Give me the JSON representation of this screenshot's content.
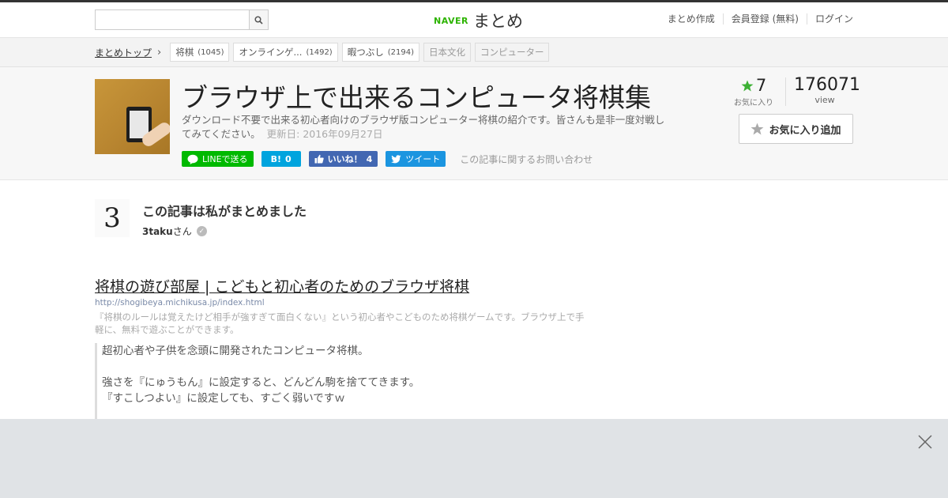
{
  "header": {
    "search": {
      "value": "",
      "placeholder": ""
    },
    "logo_naver": "NAVER",
    "logo_matome": "まとめ",
    "nav": [
      "まとめ作成",
      "会員登録 (無料)",
      "ログイン"
    ]
  },
  "breadcrumb": {
    "top": "まとめトップ",
    "tags": [
      {
        "label": "将棋",
        "count": "(1045)"
      },
      {
        "label": "オンラインゲ...",
        "count": "(1492)"
      },
      {
        "label": "暇つぶし",
        "count": "(2194)"
      },
      {
        "label": "日本文化",
        "count": ""
      },
      {
        "label": "コンピューター",
        "count": ""
      }
    ]
  },
  "article": {
    "title": "ブラウザ上で出来るコンピュータ将棋集",
    "description": "ダウンロード不要で出来る初心者向けのブラウザ版コンピューター将棋の紹介です。皆さんも是非一度対戦してみてください。",
    "updated": "更新日: 2016年09月27日",
    "share": {
      "line": "LINEで送る",
      "hatena_icon": "B!",
      "hatena_count": "0",
      "fb": "いいね！",
      "fb_count": "4",
      "tweet": "ツイート",
      "contact": "この記事に関するお問い合わせ"
    },
    "favorites_count": "7",
    "favorites_label": "お気に入り",
    "views_count": "176071",
    "views_label": "view",
    "fav_button": "お気に入り追加"
  },
  "author": {
    "avatar_text": "3",
    "heading": "この記事は私がまとめました",
    "name": "3taku",
    "suffix": "さん"
  },
  "link": {
    "title": "将棋の遊び部屋 | こどもと初心者のためのブラウザ将棋",
    "url": "http://shogibeya.michikusa.jp/index.html",
    "description": "『将棋のルールは覚えたけど相手が強すぎて面白くない』という初心者やこどものため将棋ゲームです。ブラウザ上で手軽に、無料で遊ぶことができます。",
    "quote_lines": [
      "超初心者や子供を念頭に開発されたコンピュータ将棋。",
      "強さを『にゅうもん』に設定すると、どんどん駒を捨ててきます。",
      "『すこしつよい』に設定しても、すごく弱いですｗ"
    ]
  },
  "colors": {
    "naver_green": "#2db400",
    "line_green": "#00b900",
    "hatena_blue": "#00a4de",
    "facebook_blue": "#4267b2",
    "twitter_blue": "#1b95e0",
    "star_green": "#3cb034"
  }
}
